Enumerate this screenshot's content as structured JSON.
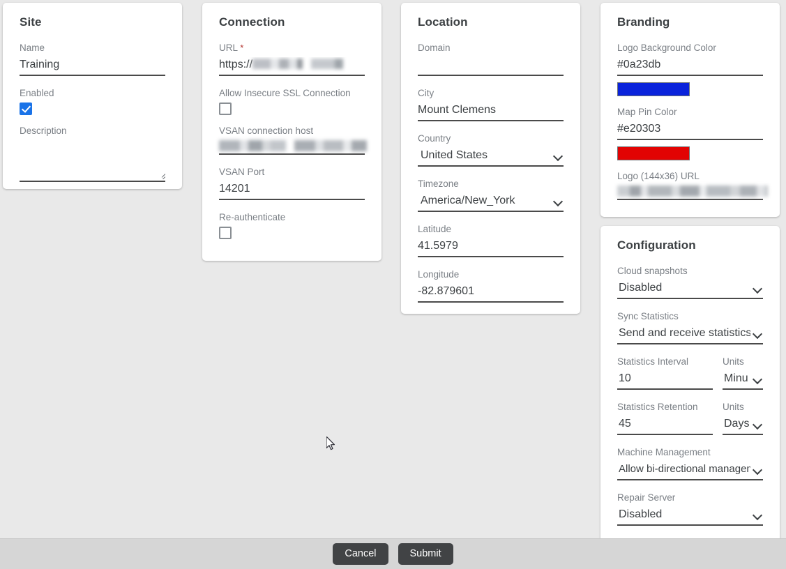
{
  "cards": {
    "site": {
      "title": "Site",
      "fields": {
        "name_label": "Name",
        "name_value": "Training",
        "enabled_label": "Enabled",
        "enabled_checked": true,
        "description_label": "Description",
        "description_value": ""
      }
    },
    "connection": {
      "title": "Connection",
      "fields": {
        "url_label": "URL",
        "url_required_marker": "*",
        "url_value_prefix": "https://",
        "url_value_redacted": true,
        "allow_insecure_label": "Allow Insecure SSL Connection",
        "allow_insecure_checked": false,
        "vsan_host_label": "VSAN connection host",
        "vsan_host_redacted": true,
        "vsan_port_label": "VSAN Port",
        "vsan_port_value": "14201",
        "reauth_label": "Re-authenticate",
        "reauth_checked": false
      }
    },
    "location": {
      "title": "Location",
      "fields": {
        "domain_label": "Domain",
        "domain_value": "",
        "city_label": "City",
        "city_value": "Mount Clemens",
        "country_label": "Country",
        "country_value": "United States",
        "timezone_label": "Timezone",
        "timezone_value": "America/New_York",
        "latitude_label": "Latitude",
        "latitude_value": "41.5979",
        "longitude_label": "Longitude",
        "longitude_value": "-82.879601"
      }
    },
    "branding": {
      "title": "Branding",
      "fields": {
        "logo_bg_label": "Logo Background Color",
        "logo_bg_value": "#0a23db",
        "logo_bg_swatch": "#0a23db",
        "map_pin_label": "Map Pin Color",
        "map_pin_value": "#e20303",
        "map_pin_swatch": "#e20303",
        "logo_url_label": "Logo (144x36) URL",
        "logo_url_redacted": true
      }
    },
    "configuration": {
      "title": "Configuration",
      "fields": {
        "cloud_snapshots_label": "Cloud snapshots",
        "cloud_snapshots_value": "Disabled",
        "sync_statistics_label": "Sync Statistics",
        "sync_statistics_value": "Send and receive statistics from t",
        "statistics_interval_label": "Statistics Interval",
        "statistics_interval_value": "10",
        "statistics_interval_units_label": "Units",
        "statistics_interval_units_value": "Minu",
        "statistics_retention_label": "Statistics Retention",
        "statistics_retention_value": "45",
        "statistics_retention_units_label": "Units",
        "statistics_retention_units_value": "Days",
        "machine_management_label": "Machine Management",
        "machine_management_value": "Allow bi-directional management",
        "repair_server_label": "Repair Server",
        "repair_server_value": "Disabled"
      }
    }
  },
  "footer": {
    "cancel_label": "Cancel",
    "submit_label": "Submit"
  },
  "theme": {
    "page_background": "#e9e9e9",
    "footer_background": "#d6d6d6",
    "card_background": "#ffffff",
    "label_color": "#7a7f85",
    "value_color": "#3c4043",
    "underline_color": "#4a4a4a",
    "checkbox_accent": "#1a73e8",
    "required_marker_color": "#b3342f",
    "button_background": "#414345",
    "button_text": "#ffffff"
  }
}
